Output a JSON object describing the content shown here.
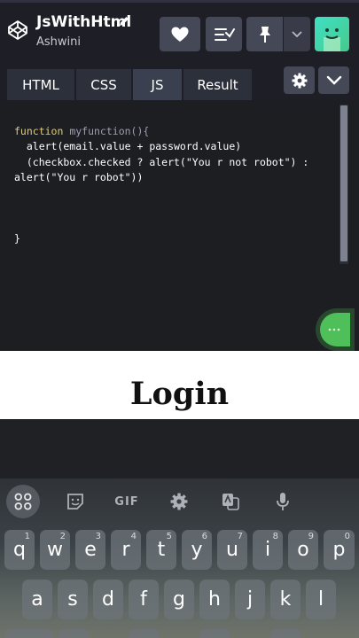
{
  "header": {
    "title": "JsWithHtml",
    "author": "Ashwini",
    "icons": [
      "codepen-logo-icon",
      "pencil-icon",
      "heart-icon",
      "collection-icon",
      "pin-icon",
      "chevron-down-icon",
      "avatar"
    ],
    "accent": "#47cf73"
  },
  "tabs": [
    "HTML",
    "CSS",
    "JS",
    "Result"
  ],
  "editor": {
    "lines": [
      [
        "function",
        " myfunction(){"
      ],
      [
        "  alert(email.value + password.value)"
      ],
      [
        "  (checkbox.checked ? alert(\"You r not robot\") :"
      ],
      [
        "alert(\"You r robot\"))"
      ],
      [
        "}"
      ]
    ]
  },
  "result": {
    "heading": "Login"
  },
  "keyboard": {
    "toolbar": {
      "gif": "GIF"
    },
    "row1": [
      {
        "k": "q",
        "h": "1"
      },
      {
        "k": "w",
        "h": "2"
      },
      {
        "k": "e",
        "h": "3"
      },
      {
        "k": "r",
        "h": "4"
      },
      {
        "k": "t",
        "h": "5"
      },
      {
        "k": "y",
        "h": "6"
      },
      {
        "k": "u",
        "h": "7"
      },
      {
        "k": "i",
        "h": "8"
      },
      {
        "k": "o",
        "h": "9"
      },
      {
        "k": "p",
        "h": "0"
      }
    ],
    "row2": [
      "a",
      "s",
      "d",
      "f",
      "g",
      "h",
      "j",
      "k",
      "l"
    ]
  }
}
